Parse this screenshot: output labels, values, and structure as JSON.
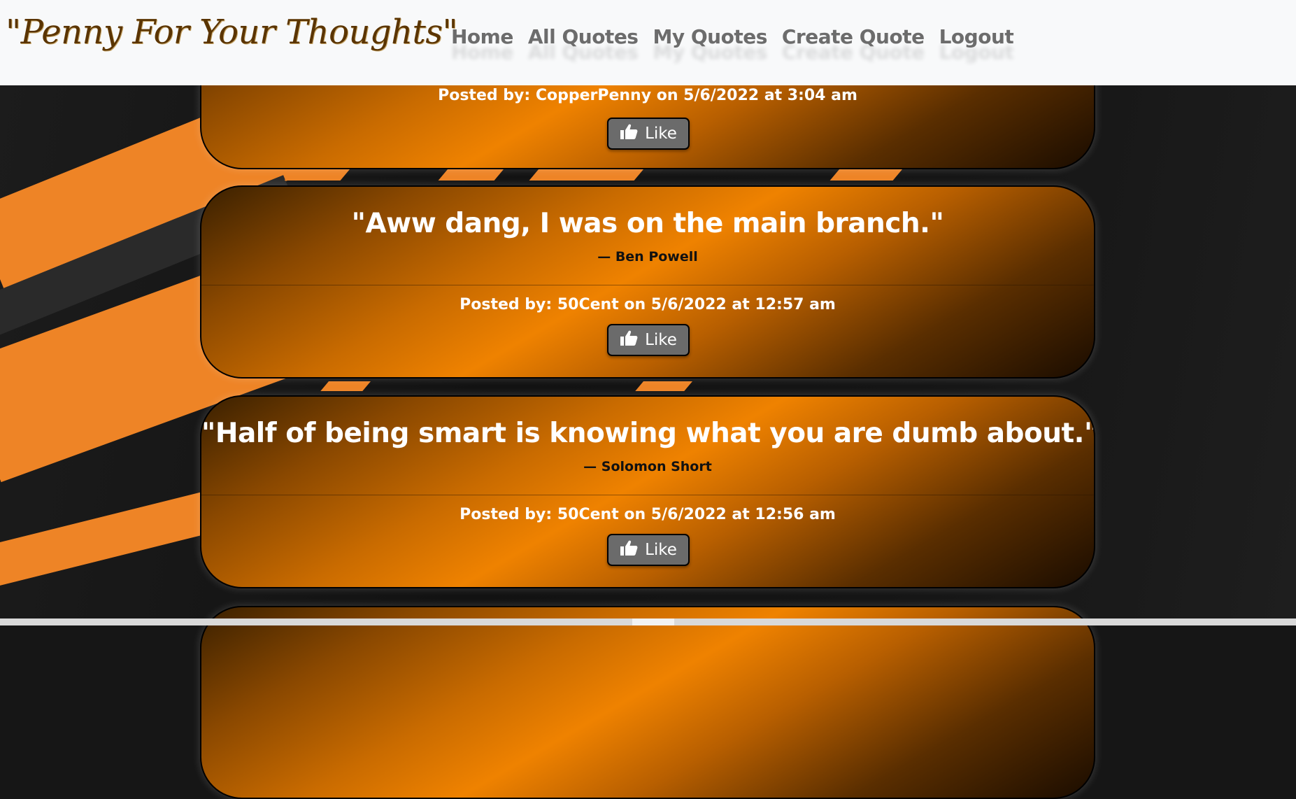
{
  "brand": {
    "title": "\"Penny For Your Thoughts\""
  },
  "nav": {
    "items": [
      {
        "label": "Home"
      },
      {
        "label": "All Quotes"
      },
      {
        "label": "My Quotes"
      },
      {
        "label": "Create Quote"
      },
      {
        "label": "Logout"
      }
    ]
  },
  "quotes": [
    {
      "text": "",
      "author": "",
      "posted": "Posted by: CopperPenny on 5/6/2022 at 3:04 am",
      "like_label": "Like"
    },
    {
      "text": "\"Aww dang, I was on the main branch.\"",
      "author": "— Ben Powell",
      "posted": "Posted by: 50Cent on 5/6/2022 at 12:57 am",
      "like_label": "Like"
    },
    {
      "text": "\"Half of being smart is knowing what you are dumb about.\"",
      "author": "— Solomon Short",
      "posted": "Posted by: 50Cent on 5/6/2022 at 12:56 am",
      "like_label": "Like"
    }
  ],
  "colors": {
    "accent": "#ef8200",
    "navbar_bg": "#f8f9fa",
    "like_button_bg": "#6b6b6b",
    "brand_text": "#5a3400"
  },
  "icons": {
    "like": "thumbs-up-icon"
  }
}
